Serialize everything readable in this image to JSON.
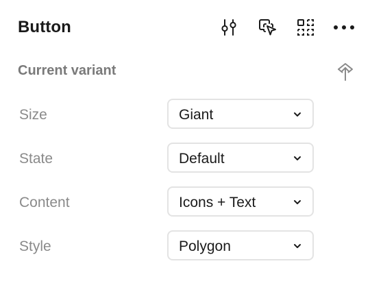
{
  "header": {
    "title": "Button",
    "icons": [
      "sliders-icon",
      "select-instance-icon",
      "component-grid-icon",
      "more-icon"
    ]
  },
  "section": {
    "title": "Current variant",
    "icon": "upload-icon"
  },
  "properties": [
    {
      "label": "Size",
      "value": "Giant"
    },
    {
      "label": "State",
      "value": "Default"
    },
    {
      "label": "Content",
      "value": "Icons + Text"
    },
    {
      "label": "Style",
      "value": "Polygon"
    }
  ],
  "colors": {
    "text": "#1a1a1a",
    "muted": "#8a8a8a",
    "border": "#e3e3e3"
  }
}
